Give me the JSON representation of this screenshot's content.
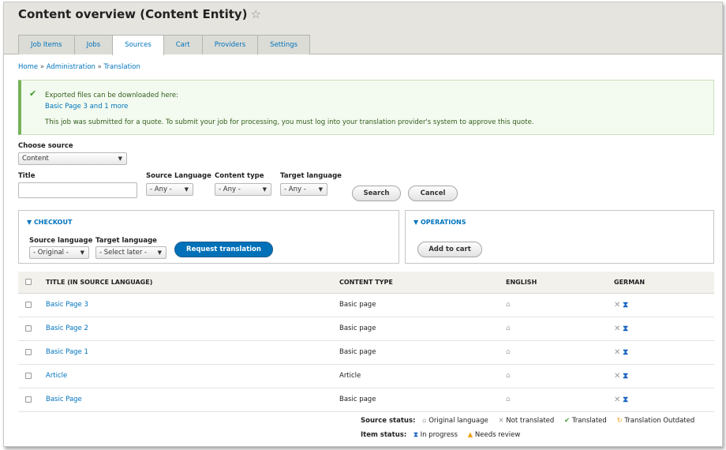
{
  "page": {
    "title": "Content overview (Content Entity)"
  },
  "tabs": [
    {
      "label": "Job Items",
      "active": false
    },
    {
      "label": "Jobs",
      "active": false
    },
    {
      "label": "Sources",
      "active": true
    },
    {
      "label": "Cart",
      "active": false
    },
    {
      "label": "Providers",
      "active": false
    },
    {
      "label": "Settings",
      "active": false
    }
  ],
  "breadcrumb": {
    "home": "Home",
    "admin": "Administration",
    "translation": "Translation",
    "separator": "»"
  },
  "message": {
    "line1": "Exported files can be downloaded here:",
    "link": "Basic Page 3 and 1 more",
    "line2": "This job was submitted for a quote. To submit your job for processing, you must log into your translation provider's system to approve this quote."
  },
  "filters": {
    "choose_source_label": "Choose source",
    "choose_source_value": "Content",
    "title_label": "Title",
    "title_value": "",
    "source_language_label": "Source Language",
    "source_language_value": "- Any -",
    "content_type_label": "Content type",
    "content_type_value": "- Any -",
    "target_language_label": "Target language",
    "target_language_value": "- Any -",
    "search_button": "Search",
    "cancel_button": "Cancel"
  },
  "checkout": {
    "title": "▼ CHECKOUT",
    "source_language_label": "Source language",
    "source_language_value": "- Original -",
    "target_language_label": "Target language",
    "target_language_value": "- Select later -",
    "request_button": "Request translation"
  },
  "operations": {
    "title": "▼ OPERATIONS",
    "add_to_cart_button": "Add to cart"
  },
  "table": {
    "headers": [
      "TITLE (IN SOURCE LANGUAGE)",
      "CONTENT TYPE",
      "ENGLISH",
      "GERMAN"
    ],
    "rows": [
      {
        "title": "Basic Page 3",
        "type": "Basic page"
      },
      {
        "title": "Basic Page 2",
        "type": "Basic page"
      },
      {
        "title": "Basic Page 1",
        "type": "Basic page"
      },
      {
        "title": "Article",
        "type": "Article"
      },
      {
        "title": "Basic Page",
        "type": "Basic page"
      }
    ]
  },
  "legend": {
    "source_status_label": "Source status:",
    "original_language": "Original language",
    "not_translated": "Not translated",
    "translated": "Translated",
    "translation_outdated": "Translation Outdated",
    "item_status_label": "Item status:",
    "in_progress": "In progress",
    "needs_review": "Needs review"
  },
  "icons": {
    "star": "star-outline-icon",
    "check": "checkmark-icon",
    "house": "house-icon",
    "x": "x-icon",
    "hourglass": "hourglass-icon",
    "outdated": "refresh-icon",
    "warning": "warning-triangle-icon"
  },
  "colors": {
    "link": "#0074bd",
    "primary_button": "#0071b8",
    "status_ok": "#77b259",
    "hourglass": "#1a66c4",
    "warning": "#f0a21a"
  }
}
